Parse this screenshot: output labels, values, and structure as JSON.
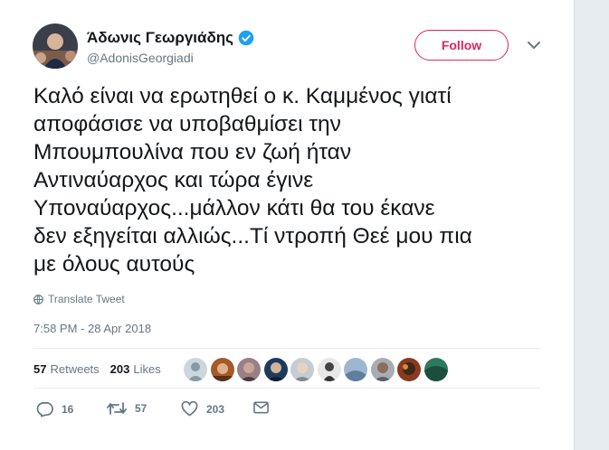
{
  "tweet": {
    "author": {
      "display_name": "Άδωνις Γεωργιάδης",
      "handle": "@AdonisGeorgiadi",
      "verified": true,
      "avatar_icon": "user-avatar"
    },
    "follow_label": "Follow",
    "text_lines": [
      "Καλό είναι να ερωτηθεί ο κ. Καμμένος γιατί",
      "αποφάσισε να υποβαθμίσει την",
      "Μπουμπουλίνα που εν ζωή ήταν",
      "Αντιναύαρχος και τώρα έγινε",
      "Υποναύαρχος...μάλλον κάτι θα του έκανε",
      "δεν εξηγείται αλλιώς...Τί ντροπή Θεέ μου πια",
      "με όλους αυτούς"
    ],
    "translate_label": "Translate Tweet",
    "timestamp": "7:58 PM - 28 Apr 2018",
    "stats": {
      "retweets_count": "57",
      "retweets_label": "Retweets",
      "likes_count": "203",
      "likes_label": "Likes"
    },
    "actions": {
      "reply_count": "16",
      "retweet_count": "57",
      "like_count": "203"
    }
  },
  "colors": {
    "accent": "#e0245e",
    "verified_blue": "#1da1f2",
    "text_primary": "#14171a",
    "text_secondary": "#657786"
  }
}
